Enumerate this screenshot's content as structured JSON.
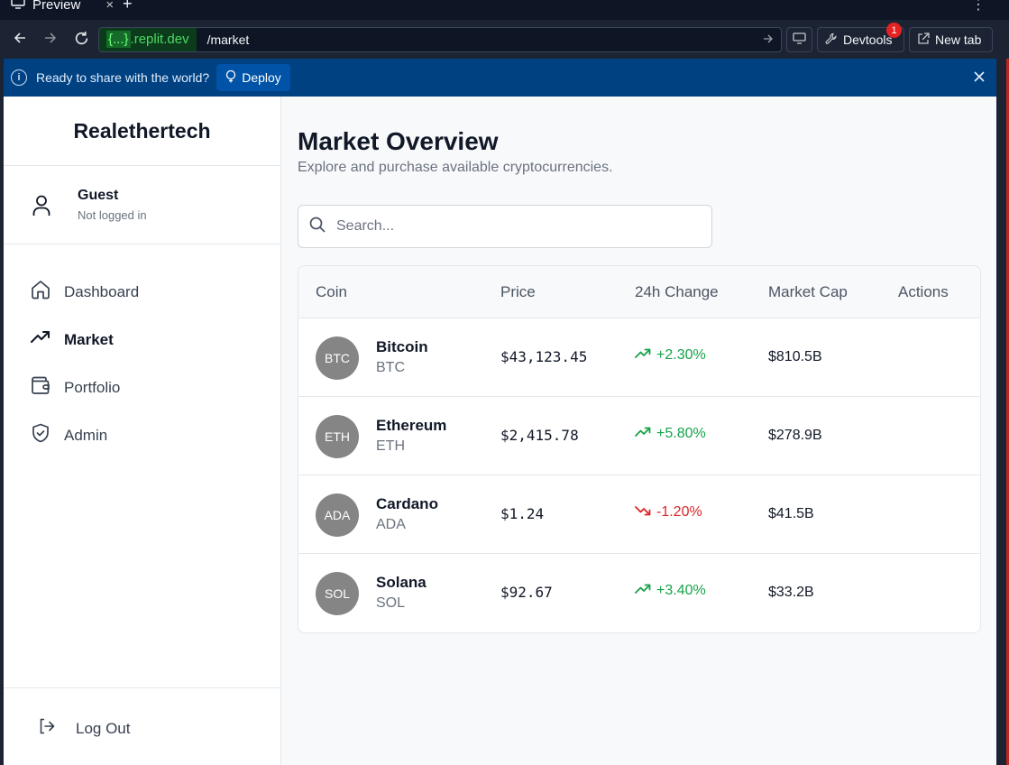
{
  "browser": {
    "tab_title": "Preview",
    "tab_close": "×",
    "tab_add": "+",
    "more": "⋮",
    "url_host_prefix": "{...}",
    "url_host_suffix": ".replit.dev",
    "url_path": "/market",
    "devtools_label": "Devtools",
    "devtools_badge": "1",
    "newtab_label": "New tab"
  },
  "banner": {
    "message": "Ready to share with the world?",
    "deploy_label": "Deploy"
  },
  "sidebar": {
    "brand": "Realethertech",
    "user_name": "Guest",
    "user_status": "Not logged in",
    "items": [
      {
        "label": "Dashboard",
        "icon": "home-icon",
        "active": false
      },
      {
        "label": "Market",
        "icon": "trending-up-icon",
        "active": true
      },
      {
        "label": "Portfolio",
        "icon": "wallet-icon",
        "active": false
      },
      {
        "label": "Admin",
        "icon": "shield-check-icon",
        "active": false
      }
    ],
    "logout_label": "Log Out"
  },
  "main": {
    "title": "Market Overview",
    "subtitle": "Explore and purchase available cryptocurrencies.",
    "search_placeholder": "Search...",
    "columns": [
      "Coin",
      "Price",
      "24h Change",
      "Market Cap",
      "Actions"
    ],
    "rows": [
      {
        "avatar": "BTC",
        "name": "Bitcoin",
        "symbol": "BTC",
        "price": "$43,123.45",
        "change": "+2.30%",
        "direction": "up",
        "market_cap": "$810.5B"
      },
      {
        "avatar": "ETH",
        "name": "Ethereum",
        "symbol": "ETH",
        "price": "$2,415.78",
        "change": "+5.80%",
        "direction": "up",
        "market_cap": "$278.9B"
      },
      {
        "avatar": "ADA",
        "name": "Cardano",
        "symbol": "ADA",
        "price": "$1.24",
        "change": "-1.20%",
        "direction": "down",
        "market_cap": "$41.5B"
      },
      {
        "avatar": "SOL",
        "name": "Solana",
        "symbol": "SOL",
        "price": "$92.67",
        "change": "+3.40%",
        "direction": "up",
        "market_cap": "$33.2B"
      }
    ]
  },
  "colors": {
    "up": "#16a34a",
    "down": "#dc2626",
    "banner": "#004182",
    "avatar": "#858585"
  }
}
